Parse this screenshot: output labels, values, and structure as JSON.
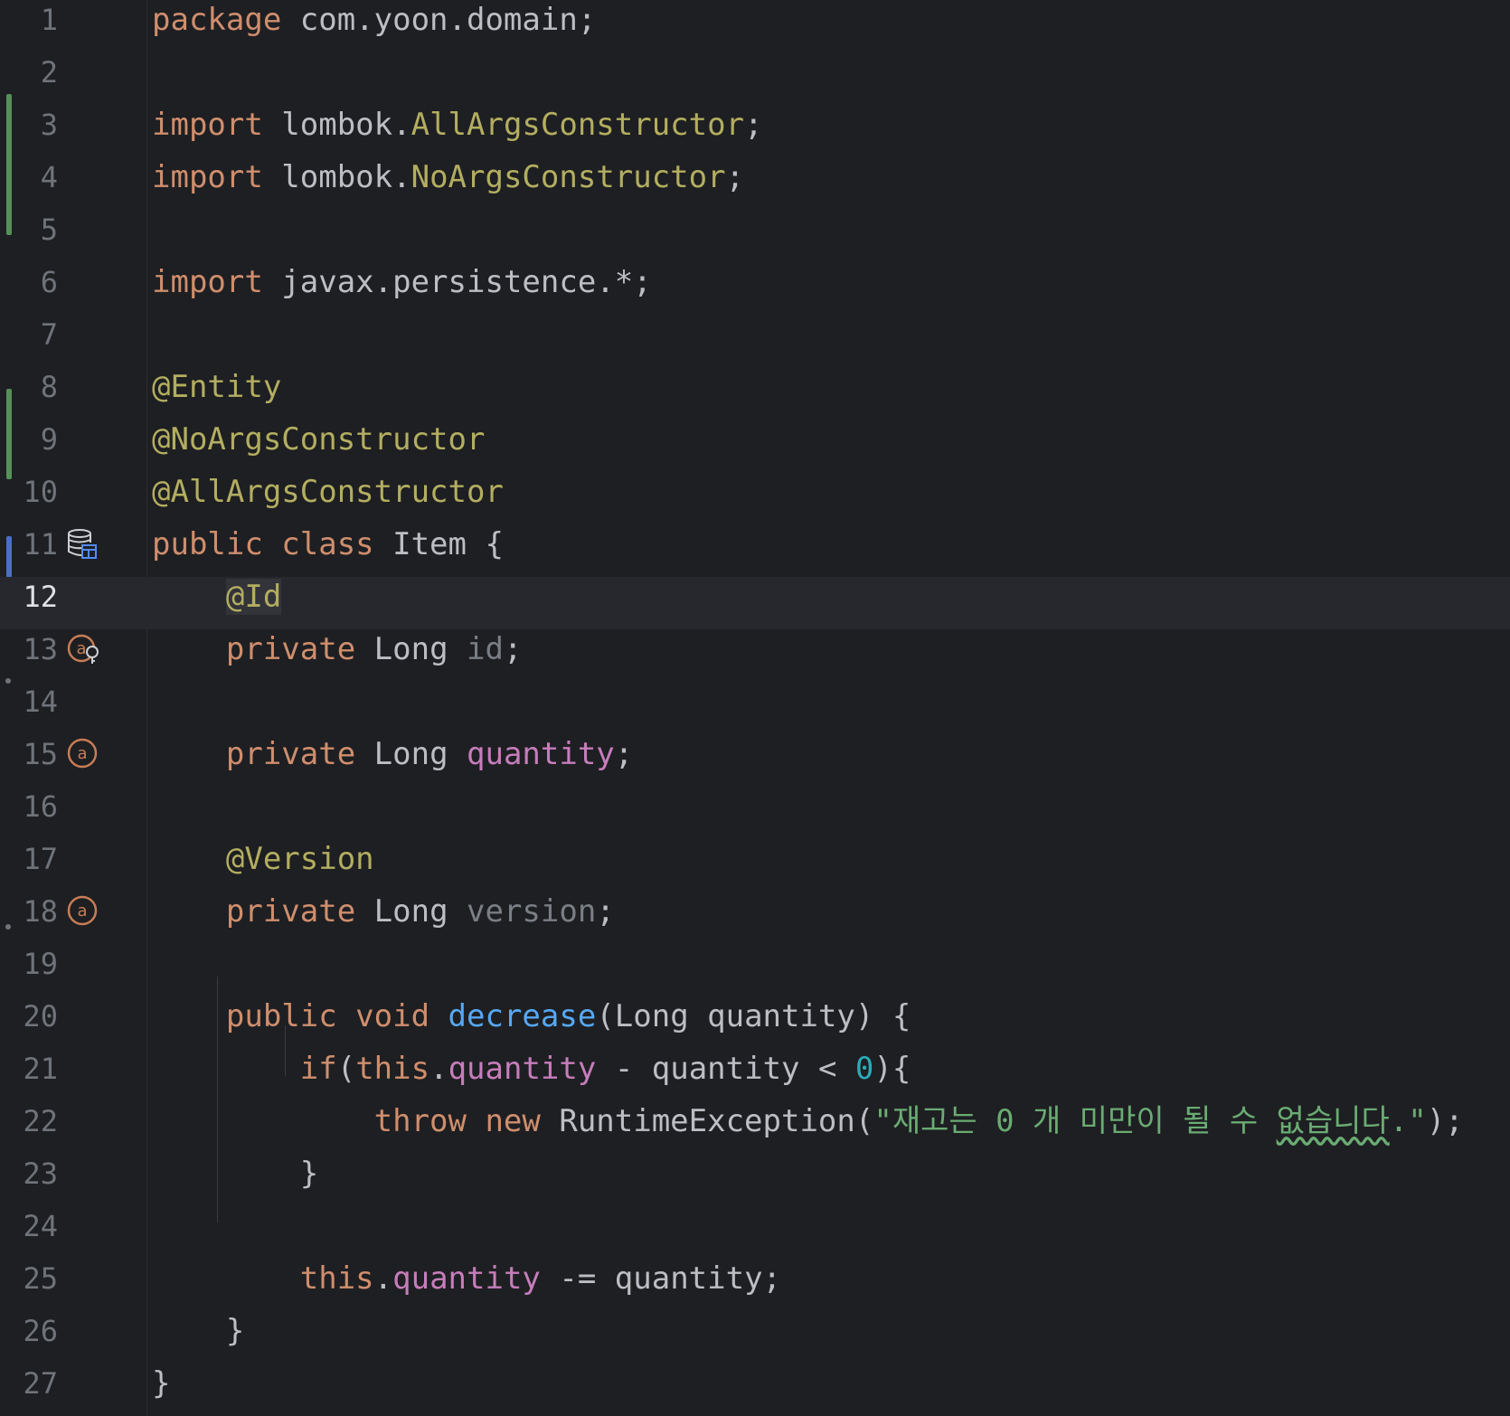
{
  "editor": {
    "language": "Java",
    "current_line": 12,
    "line_numbers": [
      "1",
      "2",
      "3",
      "4",
      "5",
      "6",
      "7",
      "8",
      "9",
      "10",
      "11",
      "12",
      "13",
      "14",
      "15",
      "16",
      "17",
      "18",
      "19",
      "20",
      "21",
      "22",
      "23",
      "24",
      "25",
      "26",
      "27"
    ],
    "lines": {
      "l1": [
        "package",
        " com.yoon.domain;"
      ],
      "l3": [
        "import",
        " lombok.",
        "AllArgsConstructor",
        ";"
      ],
      "l4": [
        "import",
        " lombok.",
        "NoArgsConstructor",
        ";"
      ],
      "l6": [
        "import",
        " javax.persistence.*;"
      ],
      "l8": [
        "@Entity"
      ],
      "l9": [
        "@NoArgsConstructor"
      ],
      "l10": [
        "@AllArgsConstructor"
      ],
      "l11": [
        "public class",
        " Item {"
      ],
      "l12": [
        "    ",
        "@Id"
      ],
      "l13": [
        "    ",
        "private",
        " Long ",
        "id",
        ";"
      ],
      "l15": [
        "    ",
        "private",
        " Long ",
        "quantity",
        ";"
      ],
      "l17": [
        "    ",
        "@Version"
      ],
      "l18": [
        "    ",
        "private",
        " Long ",
        "version",
        ";"
      ],
      "l20": [
        "    ",
        "public void",
        " ",
        "decrease",
        "(Long quantity) {"
      ],
      "l21": [
        "        ",
        "if",
        "(",
        "this",
        ".",
        "quantity",
        " - quantity < ",
        "0",
        "){"
      ],
      "l22": [
        "            ",
        "throw new",
        " RuntimeException(",
        "\"재고는 0 개 미만이 될 수 ",
        "없습니다",
        ".\"",
        ");"
      ],
      "l23": [
        "        }"
      ],
      "l25": [
        "        ",
        "this",
        ".",
        "quantity",
        " -= quantity;"
      ],
      "l26": [
        "    }"
      ],
      "l27": [
        "}"
      ]
    },
    "gutter_icons": {
      "l11": "database-table-icon",
      "l13": "id-field-annotation-icon",
      "l15": "field-annotation-icon",
      "l18": "field-annotation-icon"
    },
    "colors": {
      "background": "#1e1f22",
      "keyword": "#cf8e6d",
      "annotation": "#b3ae60",
      "field": "#c77dbb",
      "method": "#56a8f5",
      "string": "#6aab73",
      "number": "#2aacb8",
      "vcs_added": "#549159",
      "vcs_modified": "#4a6fc9"
    }
  }
}
